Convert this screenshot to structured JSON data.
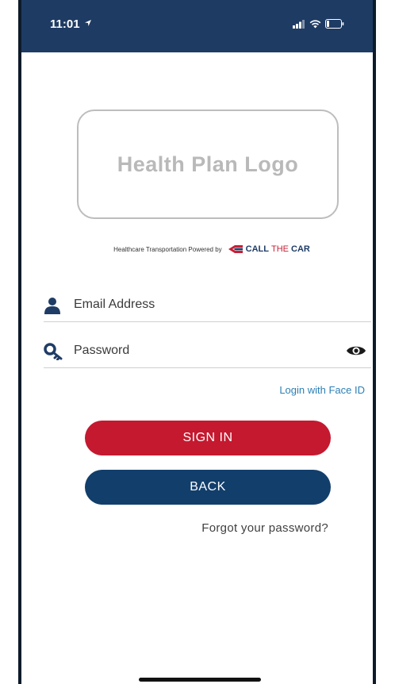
{
  "status_bar": {
    "time": "11:01",
    "location_icon": "location-arrow-icon",
    "signal_icon": "cellular-signal-icon",
    "wifi_icon": "wifi-icon",
    "battery_icon": "battery-icon"
  },
  "logo_placeholder": "Health Plan Logo",
  "powered_by": {
    "text": "Healthcare Transportation Powered by",
    "brand_call": "CALL",
    "brand_the": "THE",
    "brand_car": "CAR"
  },
  "form": {
    "email_placeholder": "Email Address",
    "email_value": "",
    "password_placeholder": "Password",
    "password_value": ""
  },
  "face_id_link": "Login with Face ID",
  "buttons": {
    "sign_in": "SIGN IN",
    "back": "BACK"
  },
  "forgot_password": "Forgot your password?",
  "colors": {
    "header": "#1e3b63",
    "sign_in": "#c4192f",
    "back": "#123e6b",
    "link": "#2d7fb5"
  }
}
